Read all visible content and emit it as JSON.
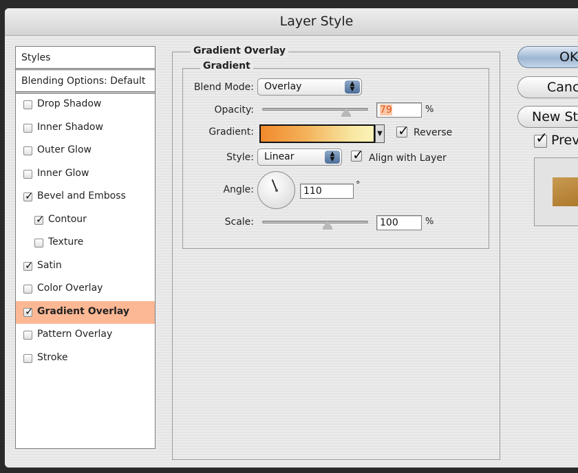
{
  "window": {
    "title": "Layer Style"
  },
  "styles_panel": {
    "header": "Styles",
    "blending_options": "Blending Options: Default",
    "items": [
      {
        "label": "Drop Shadow",
        "checked": false,
        "sub": false,
        "selected": false
      },
      {
        "label": "Inner Shadow",
        "checked": false,
        "sub": false,
        "selected": false
      },
      {
        "label": "Outer Glow",
        "checked": false,
        "sub": false,
        "selected": false
      },
      {
        "label": "Inner Glow",
        "checked": false,
        "sub": false,
        "selected": false
      },
      {
        "label": "Bevel and Emboss",
        "checked": true,
        "sub": false,
        "selected": false
      },
      {
        "label": "Contour",
        "checked": true,
        "sub": true,
        "selected": false
      },
      {
        "label": "Texture",
        "checked": false,
        "sub": true,
        "selected": false
      },
      {
        "label": "Satin",
        "checked": true,
        "sub": false,
        "selected": false
      },
      {
        "label": "Color Overlay",
        "checked": false,
        "sub": false,
        "selected": false
      },
      {
        "label": "Gradient Overlay",
        "checked": true,
        "sub": false,
        "selected": true
      },
      {
        "label": "Pattern Overlay",
        "checked": false,
        "sub": false,
        "selected": false
      },
      {
        "label": "Stroke",
        "checked": false,
        "sub": false,
        "selected": false
      }
    ]
  },
  "gradient_overlay": {
    "section_title": "Gradient Overlay",
    "group_title": "Gradient",
    "blend_mode": {
      "label": "Blend Mode:",
      "value": "Overlay"
    },
    "opacity": {
      "label": "Opacity:",
      "value": "79",
      "unit": "%",
      "level": 0.79
    },
    "gradient": {
      "label": "Gradient:",
      "reverse_label": "Reverse",
      "reverse_checked": true
    },
    "style": {
      "label": "Style:",
      "value": "Linear",
      "align_label": "Align with Layer",
      "align_checked": true
    },
    "angle": {
      "label": "Angle:",
      "value": "110",
      "unit": "°"
    },
    "scale": {
      "label": "Scale:",
      "value": "100",
      "unit": "%",
      "level": 0.62
    }
  },
  "buttons": {
    "ok": "OK",
    "cancel": "Cancel",
    "new_style": "New Style...",
    "preview": "Preview",
    "preview_checked": true
  },
  "colors": {
    "selected_row": "#fcb894",
    "gradient_start": "#f08a2c",
    "gradient_end": "#fbf4b8",
    "opacity_text": "#e0561a"
  }
}
